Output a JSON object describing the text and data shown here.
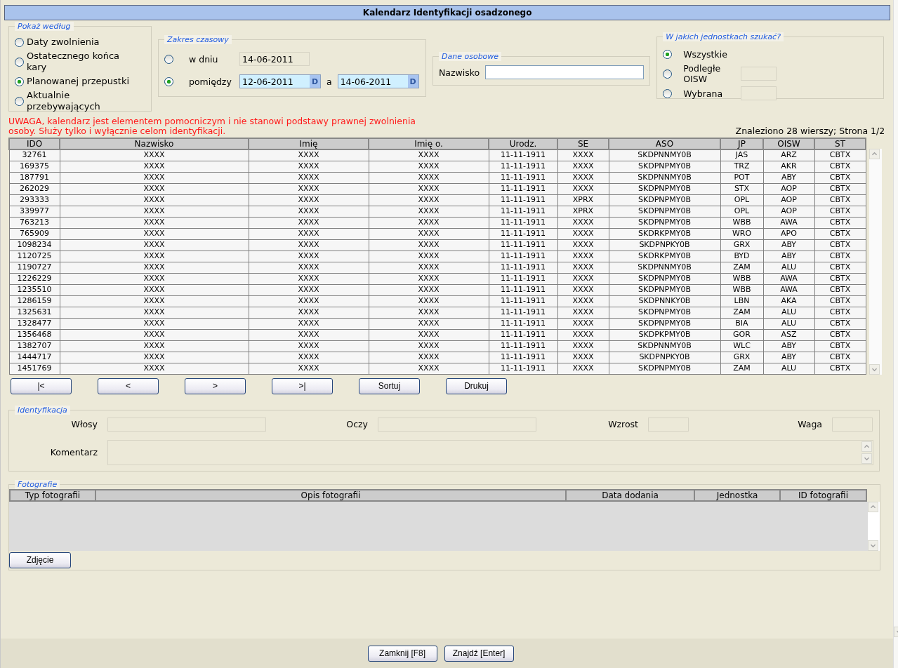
{
  "window": {
    "title": "Kalendarz Identyfikacji osadzonego"
  },
  "show_by": {
    "legend": "Pokaż według",
    "options": [
      {
        "label": "Daty zwolnienia",
        "selected": false
      },
      {
        "label": "Ostatecznego końca kary",
        "selected": false
      },
      {
        "label": "Planowanej przepustki",
        "selected": true
      },
      {
        "label": "Aktualnie przebywających",
        "selected": false
      }
    ]
  },
  "time_range": {
    "legend": "Zakres czasowy",
    "options": [
      {
        "kind": "single",
        "label": "w dniu",
        "selected": false,
        "dates": [
          {
            "value": "14-06-2011"
          }
        ]
      },
      {
        "kind": "range",
        "label": "pomiędzy",
        "selected": true,
        "separator": "a",
        "dates": [
          {
            "value": "12-06-2011",
            "picker": "D"
          },
          {
            "value": "14-06-2011",
            "picker": "D"
          }
        ]
      }
    ]
  },
  "personal": {
    "legend": "Dane osobowe",
    "fields": [
      {
        "label": "Nazwisko"
      }
    ]
  },
  "units": {
    "legend": "W jakich jednostkach szukać?",
    "options": [
      {
        "label": "Wszystkie",
        "selected": true,
        "has_field": false
      },
      {
        "label": "Podległe OISW",
        "selected": false,
        "has_field": true
      },
      {
        "label": "Wybrana",
        "selected": false,
        "has_field": true
      }
    ]
  },
  "warning": "UWAGA, kalendarz jest elementem pomocniczym i nie stanowi podstawy prawnej zwolnienia osoby. Służy tylko i wyłącznie celom identyfikacji.",
  "result_info": "Znaleziono 28 wierszy; Strona 1/2",
  "table": {
    "columns": [
      "IDO",
      "Nazwisko",
      "Imię",
      "Imię o.",
      "Urodz.",
      "SE",
      "ASO",
      "JP",
      "OISW",
      "ST"
    ],
    "rows": [
      [
        "32761",
        "XXXX",
        "XXXX",
        "XXXX",
        "11-11-1911",
        "XXXX",
        "SKDPNNMY0B",
        "JAS",
        "ARZ",
        "CBTX"
      ],
      [
        "169375",
        "XXXX",
        "XXXX",
        "XXXX",
        "11-11-1911",
        "XXXX",
        "SKDPNPMY0B",
        "TRZ",
        "AKR",
        "CBTX"
      ],
      [
        "187791",
        "XXXX",
        "XXXX",
        "XXXX",
        "11-11-1911",
        "XXXX",
        "SKDPNNMY0B",
        "POT",
        "ABY",
        "CBTX"
      ],
      [
        "262029",
        "XXXX",
        "XXXX",
        "XXXX",
        "11-11-1911",
        "XXXX",
        "SKDPNPMY0B",
        "STX",
        "AOP",
        "CBTX"
      ],
      [
        "293333",
        "XXXX",
        "XXXX",
        "XXXX",
        "11-11-1911",
        "XPRX",
        "SKDPNPMY0B",
        "OPL",
        "AOP",
        "CBTX"
      ],
      [
        "339977",
        "XXXX",
        "XXXX",
        "XXXX",
        "11-11-1911",
        "XPRX",
        "SKDPNPMY0B",
        "OPL",
        "AOP",
        "CBTX"
      ],
      [
        "763213",
        "XXXX",
        "XXXX",
        "XXXX",
        "11-11-1911",
        "XXXX",
        "SKDPNPMY0B",
        "WBB",
        "AWA",
        "CBTX"
      ],
      [
        "765909",
        "XXXX",
        "XXXX",
        "XXXX",
        "11-11-1911",
        "XXXX",
        "SKDRKPMY0B",
        "WRO",
        "APO",
        "CBTX"
      ],
      [
        "1098234",
        "XXXX",
        "XXXX",
        "XXXX",
        "11-11-1911",
        "XXXX",
        "SKDPNPKY0B",
        "GRX",
        "ABY",
        "CBTX"
      ],
      [
        "1120725",
        "XXXX",
        "XXXX",
        "XXXX",
        "11-11-1911",
        "XXXX",
        "SKDRKPMY0B",
        "BYD",
        "ABY",
        "CBTX"
      ],
      [
        "1190727",
        "XXXX",
        "XXXX",
        "XXXX",
        "11-11-1911",
        "XXXX",
        "SKDPNNMY0B",
        "ZAM",
        "ALU",
        "CBTX"
      ],
      [
        "1226229",
        "XXXX",
        "XXXX",
        "XXXX",
        "11-11-1911",
        "XXXX",
        "SKDPNPMY0B",
        "WBB",
        "AWA",
        "CBTX"
      ],
      [
        "1235510",
        "XXXX",
        "XXXX",
        "XXXX",
        "11-11-1911",
        "XXXX",
        "SKDPNPMY0B",
        "WBB",
        "AWA",
        "CBTX"
      ],
      [
        "1286159",
        "XXXX",
        "XXXX",
        "XXXX",
        "11-11-1911",
        "XXXX",
        "SKDPNNKY0B",
        "LBN",
        "AKA",
        "CBTX"
      ],
      [
        "1325631",
        "XXXX",
        "XXXX",
        "XXXX",
        "11-11-1911",
        "XXXX",
        "SKDPNPMY0B",
        "ZAM",
        "ALU",
        "CBTX"
      ],
      [
        "1328477",
        "XXXX",
        "XXXX",
        "XXXX",
        "11-11-1911",
        "XXXX",
        "SKDPNPMY0B",
        "BIA",
        "ALU",
        "CBTX"
      ],
      [
        "1356468",
        "XXXX",
        "XXXX",
        "XXXX",
        "11-11-1911",
        "XXXX",
        "SKDPKPMY0B",
        "GOR",
        "ASZ",
        "CBTX"
      ],
      [
        "1382707",
        "XXXX",
        "XXXX",
        "XXXX",
        "11-11-1911",
        "XXXX",
        "SKDPNNMY0B",
        "WLC",
        "ABY",
        "CBTX"
      ],
      [
        "1444717",
        "XXXX",
        "XXXX",
        "XXXX",
        "11-11-1911",
        "XXXX",
        "SKDPNPKY0B",
        "GRX",
        "ABY",
        "CBTX"
      ],
      [
        "1451769",
        "XXXX",
        "XXXX",
        "XXXX",
        "11-11-1911",
        "XXXX",
        "SKDPNPMY0B",
        "ZAM",
        "ALU",
        "CBTX"
      ]
    ]
  },
  "pager_buttons": [
    "|<",
    "<",
    ">",
    ">|",
    "Sortuj",
    "Drukuj"
  ],
  "identification": {
    "legend": "Identyfikacja",
    "fields": [
      {
        "label": "Włosy",
        "kind": "wide"
      },
      {
        "label": "Oczy",
        "kind": "wide"
      },
      {
        "label": "Wzrost",
        "kind": "short"
      },
      {
        "label": "Waga",
        "kind": "short"
      }
    ],
    "comment": {
      "label": "Komentarz"
    }
  },
  "photos": {
    "legend": "Fotografie",
    "columns": [
      "Typ fotografii",
      "Opis fotografii",
      "Data dodania",
      "Jednostka",
      "ID fotografii"
    ],
    "button": "Zdjęcie"
  },
  "footer_buttons": [
    "Zamknij [F8]",
    "Znajdź [Enter]"
  ]
}
